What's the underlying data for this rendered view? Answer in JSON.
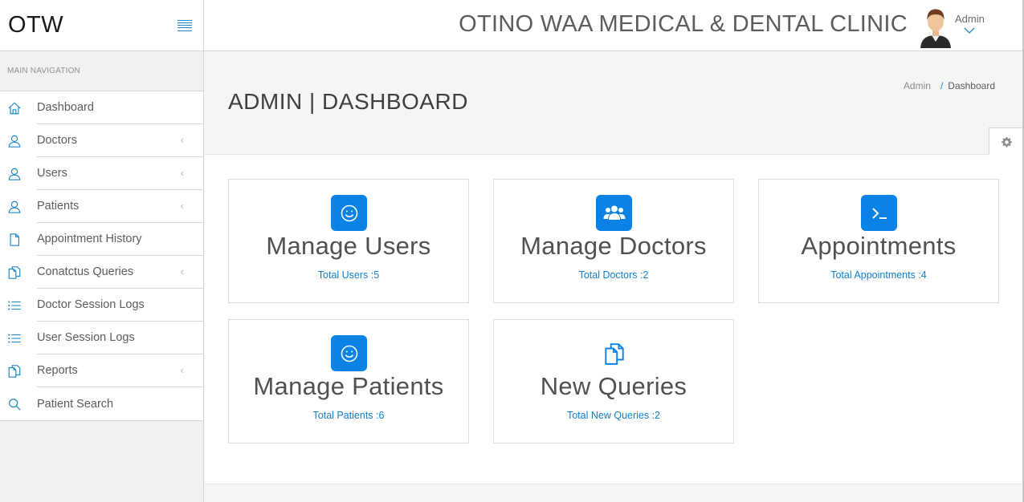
{
  "brand": {
    "name": "OTW"
  },
  "header": {
    "clinic_name": "OTINO WAA MEDICAL & DENTAL CLINIC",
    "user_label": "Admin"
  },
  "sidebar": {
    "section_title": "MAIN NAVIGATION",
    "items": [
      {
        "label": "Dashboard",
        "icon": "home-icon",
        "has_submenu": false
      },
      {
        "label": "Doctors",
        "icon": "user-icon",
        "has_submenu": true
      },
      {
        "label": "Users",
        "icon": "user-icon",
        "has_submenu": true
      },
      {
        "label": "Patients",
        "icon": "user-icon",
        "has_submenu": true
      },
      {
        "label": "Appointment History",
        "icon": "file-icon",
        "has_submenu": false
      },
      {
        "label": "Conatctus Queries",
        "icon": "files-icon",
        "has_submenu": true
      },
      {
        "label": "Doctor Session Logs",
        "icon": "list-icon",
        "has_submenu": false
      },
      {
        "label": "User Session Logs",
        "icon": "list-icon",
        "has_submenu": false
      },
      {
        "label": "Reports",
        "icon": "files-icon",
        "has_submenu": true
      },
      {
        "label": "Patient Search",
        "icon": "search-icon",
        "has_submenu": false
      }
    ]
  },
  "page": {
    "title": "ADMIN | DASHBOARD",
    "breadcrumb": {
      "root": "Admin",
      "separator": "/",
      "current": "Dashboard"
    }
  },
  "cards": [
    {
      "title": "Manage Users",
      "link": "Total Users :5",
      "icon": "smile-icon"
    },
    {
      "title": "Manage Doctors",
      "link": "Total Doctors :2",
      "icon": "users-group-icon"
    },
    {
      "title": "Appointments",
      "link": "Total Appointments :4",
      "icon": "terminal-icon"
    },
    {
      "title": "Manage Patients",
      "link": "Total Patients :6",
      "icon": "smile-icon"
    },
    {
      "title": "New Queries",
      "link": "Total New Queries :2",
      "icon": "files-icon"
    }
  ],
  "colors": {
    "accent": "#0a82e6",
    "link": "#0f7fd1",
    "sidebar_icon": "#1e88c7"
  }
}
